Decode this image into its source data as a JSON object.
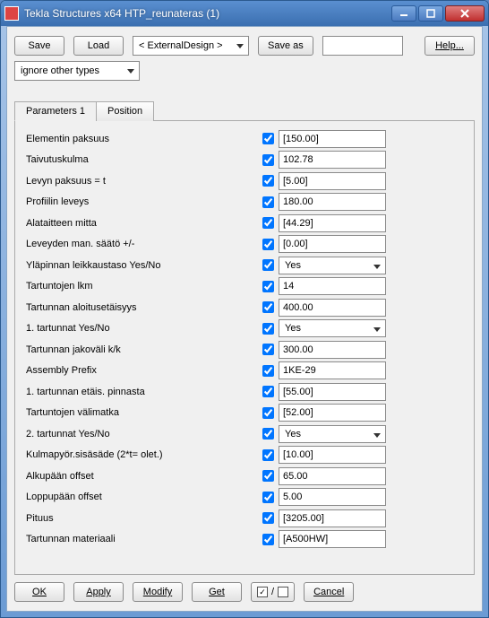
{
  "title": "Tekla Structures x64  HTP_reunateras (1)",
  "toolbar": {
    "save": "Save",
    "load": "Load",
    "design_select": "< ExternalDesign >",
    "save_as": "Save as",
    "save_as_value": "",
    "help": "Help...",
    "ignore": "ignore other types"
  },
  "tabs": {
    "parameters": "Parameters 1",
    "position": "Position"
  },
  "params": [
    {
      "label": "Elementin paksuus",
      "value": "[150.00]",
      "type": "text"
    },
    {
      "label": "Taivutuskulma",
      "value": "102.78",
      "type": "text"
    },
    {
      "label": "Levyn paksuus = t",
      "value": "[5.00]",
      "type": "text"
    },
    {
      "label": "Profiilin leveys",
      "value": "180.00",
      "type": "text"
    },
    {
      "label": "Alataitteen mitta",
      "value": "[44.29]",
      "type": "text"
    },
    {
      "label": "Leveyden man. säätö +/-",
      "value": "[0.00]",
      "type": "text"
    },
    {
      "label": "Yläpinnan leikkaustaso Yes/No",
      "value": "Yes",
      "type": "select"
    },
    {
      "label": "Tartuntojen lkm",
      "value": "14",
      "type": "text"
    },
    {
      "label": "Tartunnan aloitusetäisyys",
      "value": "400.00",
      "type": "text"
    },
    {
      "label": "1. tartunnat Yes/No",
      "value": "Yes",
      "type": "select"
    },
    {
      "label": "Tartunnan jakoväli k/k",
      "value": "300.00",
      "type": "text"
    },
    {
      "label": "Assembly Prefix",
      "value": "1KE-29",
      "type": "text"
    },
    {
      "label": "1. tartunnan etäis. pinnasta",
      "value": "[55.00]",
      "type": "text"
    },
    {
      "label": "Tartuntojen välimatka",
      "value": "[52.00]",
      "type": "text"
    },
    {
      "label": "2. tartunnat Yes/No",
      "value": "Yes",
      "type": "select"
    },
    {
      "label": "Kulmapyör.sisäsäde (2*t= olet.)",
      "value": "[10.00]",
      "type": "text"
    },
    {
      "label": "Alkupään offset",
      "value": "65.00",
      "type": "text"
    },
    {
      "label": "Loppupään offset",
      "value": "5.00",
      "type": "text"
    },
    {
      "label": "Pituus",
      "value": "[3205.00]",
      "type": "text"
    },
    {
      "label": "Tartunnan materiaali",
      "value": "[A500HW]",
      "type": "text"
    }
  ],
  "bottom": {
    "ok": "OK",
    "apply": "Apply",
    "modify": "Modify",
    "get": "Get",
    "cancel": "Cancel"
  }
}
